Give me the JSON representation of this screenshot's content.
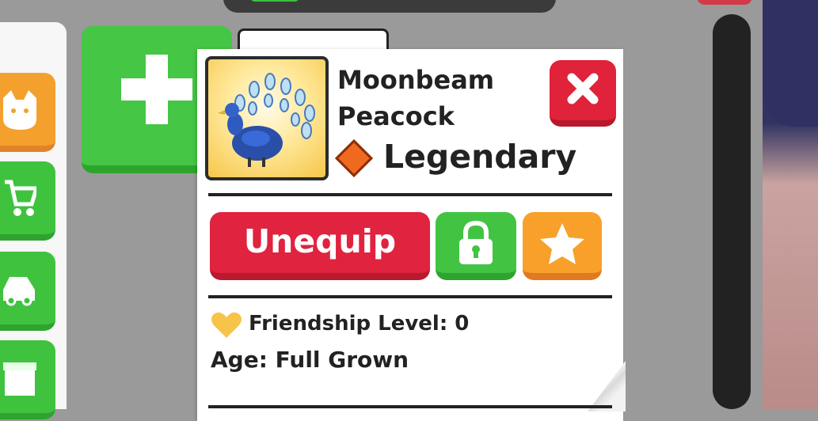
{
  "pet": {
    "name_line1": "Moonbeam",
    "name_line2": "Peacock",
    "rarity": "Legendary"
  },
  "actions": {
    "unequip_label": "Unequip"
  },
  "stats": {
    "friendship_text": "Friendship Level: 0",
    "age_text": "Age: Full Grown"
  },
  "colors": {
    "accent_red": "#e0233e",
    "accent_green": "#42c442",
    "accent_orange": "#f8a02a",
    "legendary": "#ef6a1e"
  },
  "icons": {
    "close": "close-icon",
    "lock": "lock-icon",
    "favorite": "star-icon",
    "friendship": "heart-icon",
    "rarity": "diamond-icon"
  }
}
